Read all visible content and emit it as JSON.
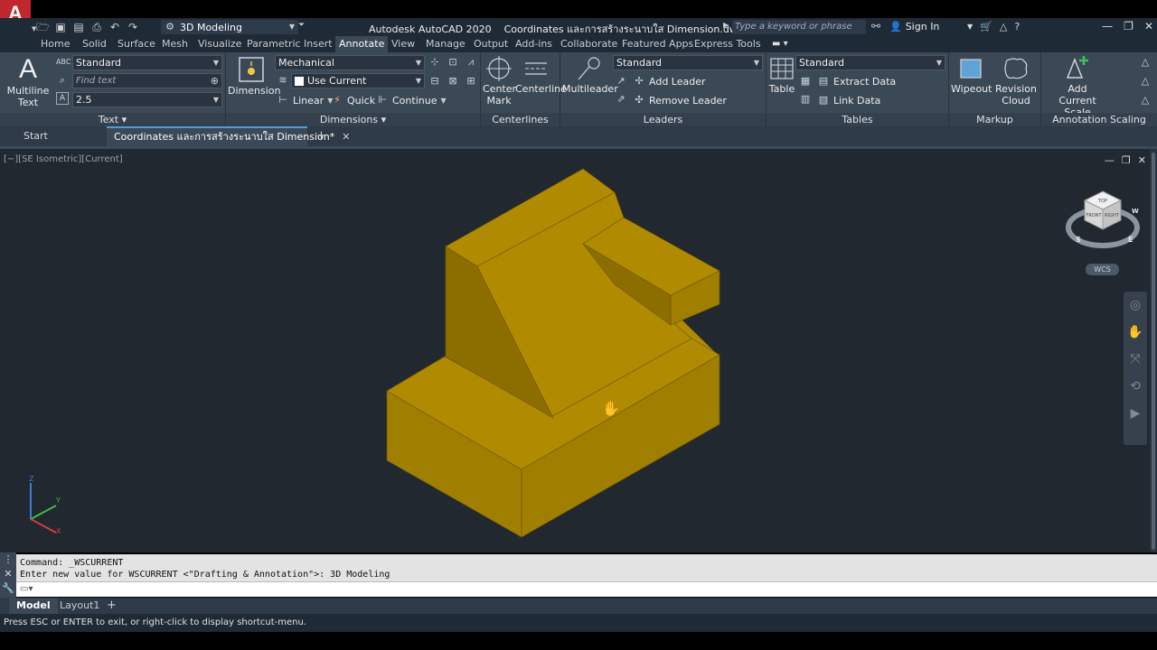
{
  "title_bar": {
    "logo": "A",
    "workspace": "3D Modeling",
    "app_title": "Autodesk AutoCAD 2020",
    "file_title": "Coordinates และการสร้างระนาบใส Dimension.dwg",
    "search_placeholder": "Type a keyword or phrase",
    "sign_in": "Sign In"
  },
  "ribbon_tabs": [
    "Home",
    "Solid",
    "Surface",
    "Mesh",
    "Visualize",
    "Parametric",
    "Insert",
    "Annotate",
    "View",
    "Manage",
    "Output",
    "Add-ins",
    "Collaborate",
    "Featured Apps",
    "Express Tools"
  ],
  "active_tab": "Annotate",
  "panels": {
    "text": {
      "title": "Text",
      "big_label_1": "Multiline",
      "big_label_2": "Text",
      "style": "Standard",
      "find_placeholder": "Find text",
      "height": "2.5"
    },
    "dimensions": {
      "title": "Dimensions",
      "big_label": "Dimension",
      "style": "Mechanical",
      "layer": "Use Current",
      "linear": "Linear",
      "quick": "Quick",
      "continue": "Continue"
    },
    "centerlines": {
      "title": "Centerlines",
      "center_mark_1": "Center",
      "center_mark_2": "Mark",
      "centerline": "Centerline"
    },
    "leaders": {
      "title": "Leaders",
      "big_label": "Multileader",
      "style": "Standard",
      "add_leader": "Add Leader",
      "remove_leader": "Remove Leader"
    },
    "tables": {
      "title": "Tables",
      "big_label": "Table",
      "style": "Standard",
      "extract_data": "Extract Data",
      "link_data": "Link Data"
    },
    "markup": {
      "title": "Markup",
      "wipeout": "Wipeout",
      "revision_1": "Revision",
      "revision_2": "Cloud"
    },
    "annotation_scaling": {
      "title": "Annotation Scaling",
      "add_1": "Add",
      "add_2": "Current Scale"
    }
  },
  "file_tabs": {
    "start": "Start",
    "active": "Coordinates และการสร้างระนาบใส Dimension*"
  },
  "viewport": {
    "label": "[−][SE Isometric][Current]",
    "wcs": "WCS",
    "viewcube_top": "TOP",
    "viewcube_front": "FRONT",
    "viewcube_right": "RIGHT",
    "compass_s": "S",
    "compass_e": "E",
    "compass_w": "W"
  },
  "command_line": {
    "line1": "Command: _WSCURRENT",
    "line2": "Enter new value for WSCURRENT <\"Drafting & Annotation\">: 3D Modeling"
  },
  "layout_tabs": [
    "Model",
    "Layout1"
  ],
  "status_text": "Press ESC or ENTER to exit, or right-click to display shortcut-menu.",
  "colors": {
    "model_top": "#b08a00",
    "model_front": "#a07e00",
    "model_side": "#8c6d00",
    "accent": "#4c9ed9"
  }
}
